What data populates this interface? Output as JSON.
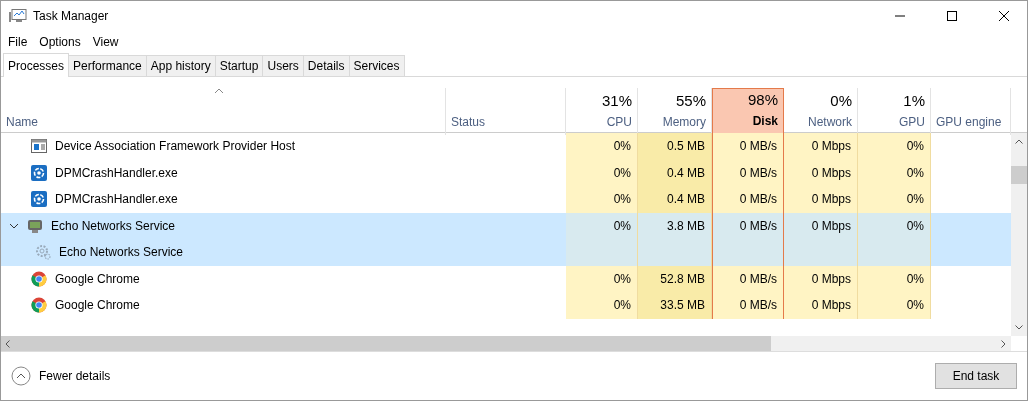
{
  "window": {
    "title": "Task Manager"
  },
  "menu": [
    "File",
    "Options",
    "View"
  ],
  "tabs": [
    {
      "label": "Processes",
      "selected": true
    },
    {
      "label": "Performance",
      "selected": false
    },
    {
      "label": "App history",
      "selected": false
    },
    {
      "label": "Startup",
      "selected": false
    },
    {
      "label": "Users",
      "selected": false
    },
    {
      "label": "Details",
      "selected": false
    },
    {
      "label": "Services",
      "selected": false
    }
  ],
  "columns": [
    {
      "label": "Name",
      "kind": "name",
      "sorted": true
    },
    {
      "label": "Status",
      "kind": "text"
    },
    {
      "label": "CPU",
      "summary": "31%",
      "kind": "metric",
      "highlighted": false
    },
    {
      "label": "Memory",
      "summary": "55%",
      "kind": "metric",
      "highlighted": false
    },
    {
      "label": "Disk",
      "summary": "98%",
      "kind": "metric",
      "highlighted": true
    },
    {
      "label": "Network",
      "summary": "0%",
      "kind": "metric",
      "highlighted": false
    },
    {
      "label": "GPU",
      "summary": "1%",
      "kind": "metric",
      "highlighted": false
    },
    {
      "label": "GPU engine",
      "kind": "text"
    }
  ],
  "rows": [
    {
      "name": "Device Association Framework Provider Host",
      "kind": "window",
      "selected": false,
      "cells": [
        "0%",
        "0.5 MB",
        "0 MB/s",
        "0 Mbps",
        "0%"
      ]
    },
    {
      "name": "DPMCrashHandler.exe",
      "kind": "gear-blue",
      "selected": false,
      "cells": [
        "0%",
        "0.4 MB",
        "0 MB/s",
        "0 Mbps",
        "0%"
      ]
    },
    {
      "name": "DPMCrashHandler.exe",
      "kind": "gear-blue",
      "selected": false,
      "cells": [
        "0%",
        "0.4 MB",
        "0 MB/s",
        "0 Mbps",
        "0%"
      ]
    },
    {
      "name": "Echo Networks Service",
      "kind": "monitor",
      "selected": true,
      "expanded": true,
      "cells": [
        "0%",
        "3.8 MB",
        "0 MB/s",
        "0 Mbps",
        "0%"
      ],
      "children": [
        {
          "name": "Echo Networks Service",
          "kind": "gear"
        }
      ]
    },
    {
      "name": "Google Chrome",
      "kind": "chrome",
      "selected": false,
      "cells": [
        "0%",
        "52.8 MB",
        "0 MB/s",
        "0 Mbps",
        "0%"
      ]
    },
    {
      "name": "Google Chrome",
      "kind": "chrome",
      "selected": false,
      "cells": [
        "0%",
        "33.5 MB",
        "0 MB/s",
        "0 Mbps",
        "0%"
      ]
    }
  ],
  "footer": {
    "toggle": "Fewer details",
    "button": "End task"
  }
}
